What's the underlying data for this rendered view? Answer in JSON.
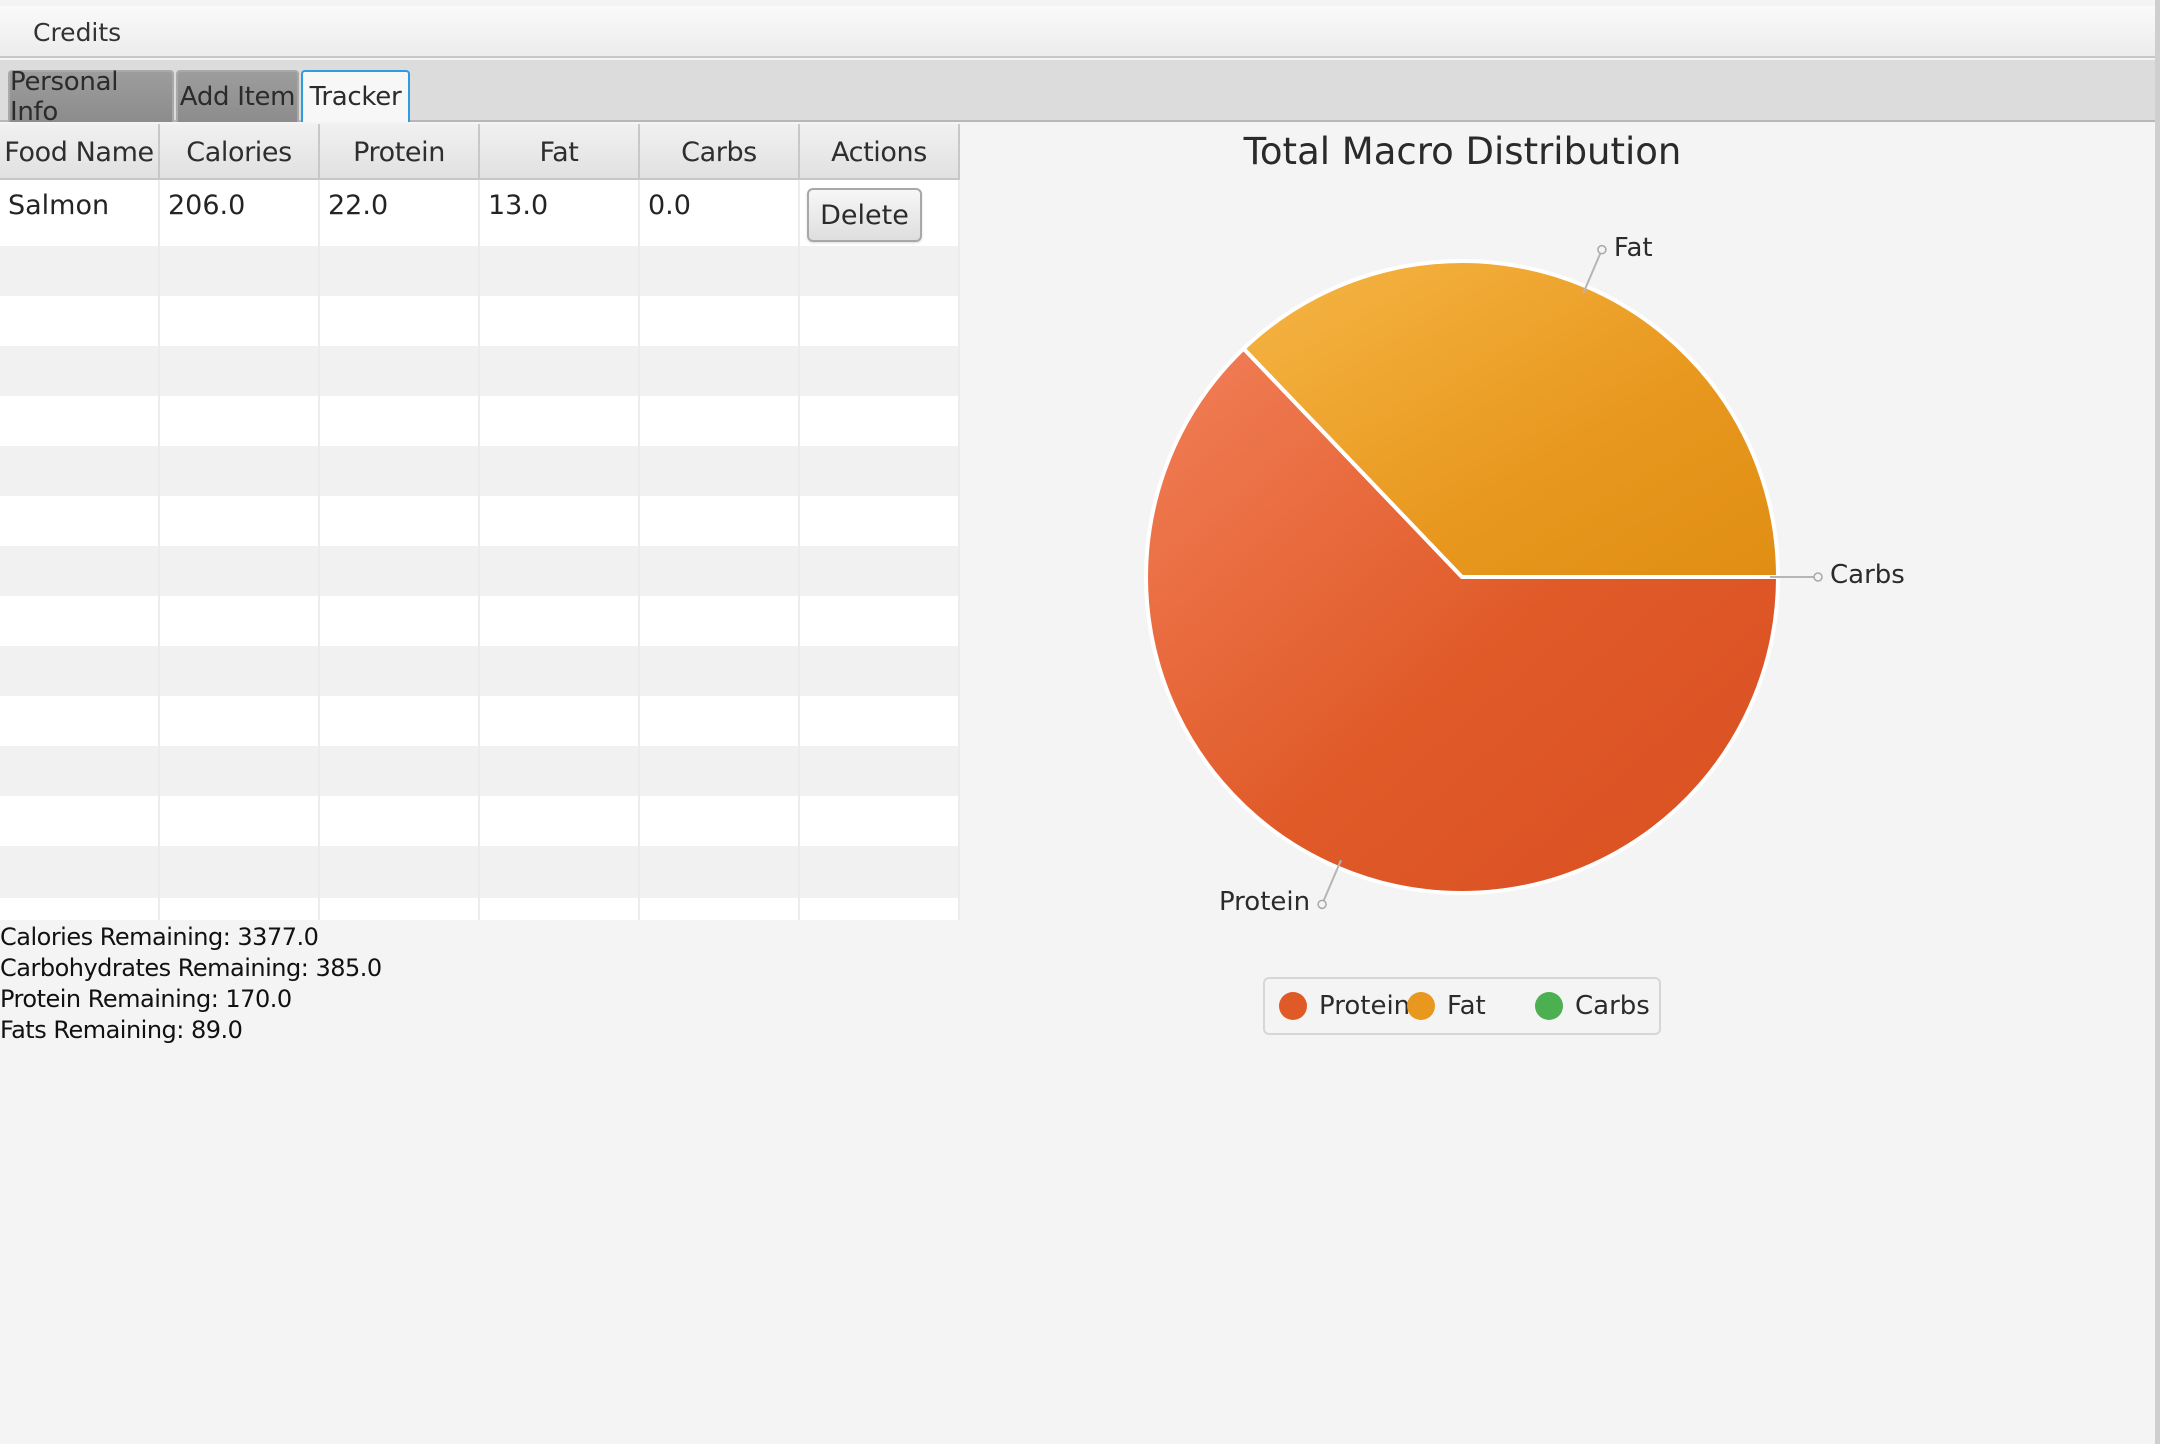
{
  "menubar": {
    "credits_label": "Credits"
  },
  "tabs": [
    {
      "label": "Personal Info",
      "selected": false
    },
    {
      "label": "Add Item",
      "selected": false
    },
    {
      "label": "Tracker",
      "selected": true
    }
  ],
  "table": {
    "columns": [
      "Food Name",
      "Calories",
      "Protein",
      "Fat",
      "Carbs",
      "Actions"
    ],
    "rows": [
      {
        "food_name": "Salmon",
        "calories": "206.0",
        "protein": "22.0",
        "fat": "13.0",
        "carbs": "0.0",
        "action_label": "Delete"
      }
    ]
  },
  "summary": {
    "calories": "Calories Remaining: 3377.0",
    "carbohydrates": "Carbohydrates Remaining: 385.0",
    "protein": "Protein Remaining: 170.0",
    "fats": "Fats Remaining: 89.0"
  },
  "chart_data": {
    "type": "pie",
    "title": "Total Macro Distribution",
    "legend_position": "bottom",
    "slices": [
      {
        "label": "Protein",
        "value": 22.0,
        "color": "#e05a28"
      },
      {
        "label": "Fat",
        "value": 13.0,
        "color": "#e8981e"
      },
      {
        "label": "Carbs",
        "value": 0.0,
        "color": "#4caf50"
      }
    ]
  }
}
